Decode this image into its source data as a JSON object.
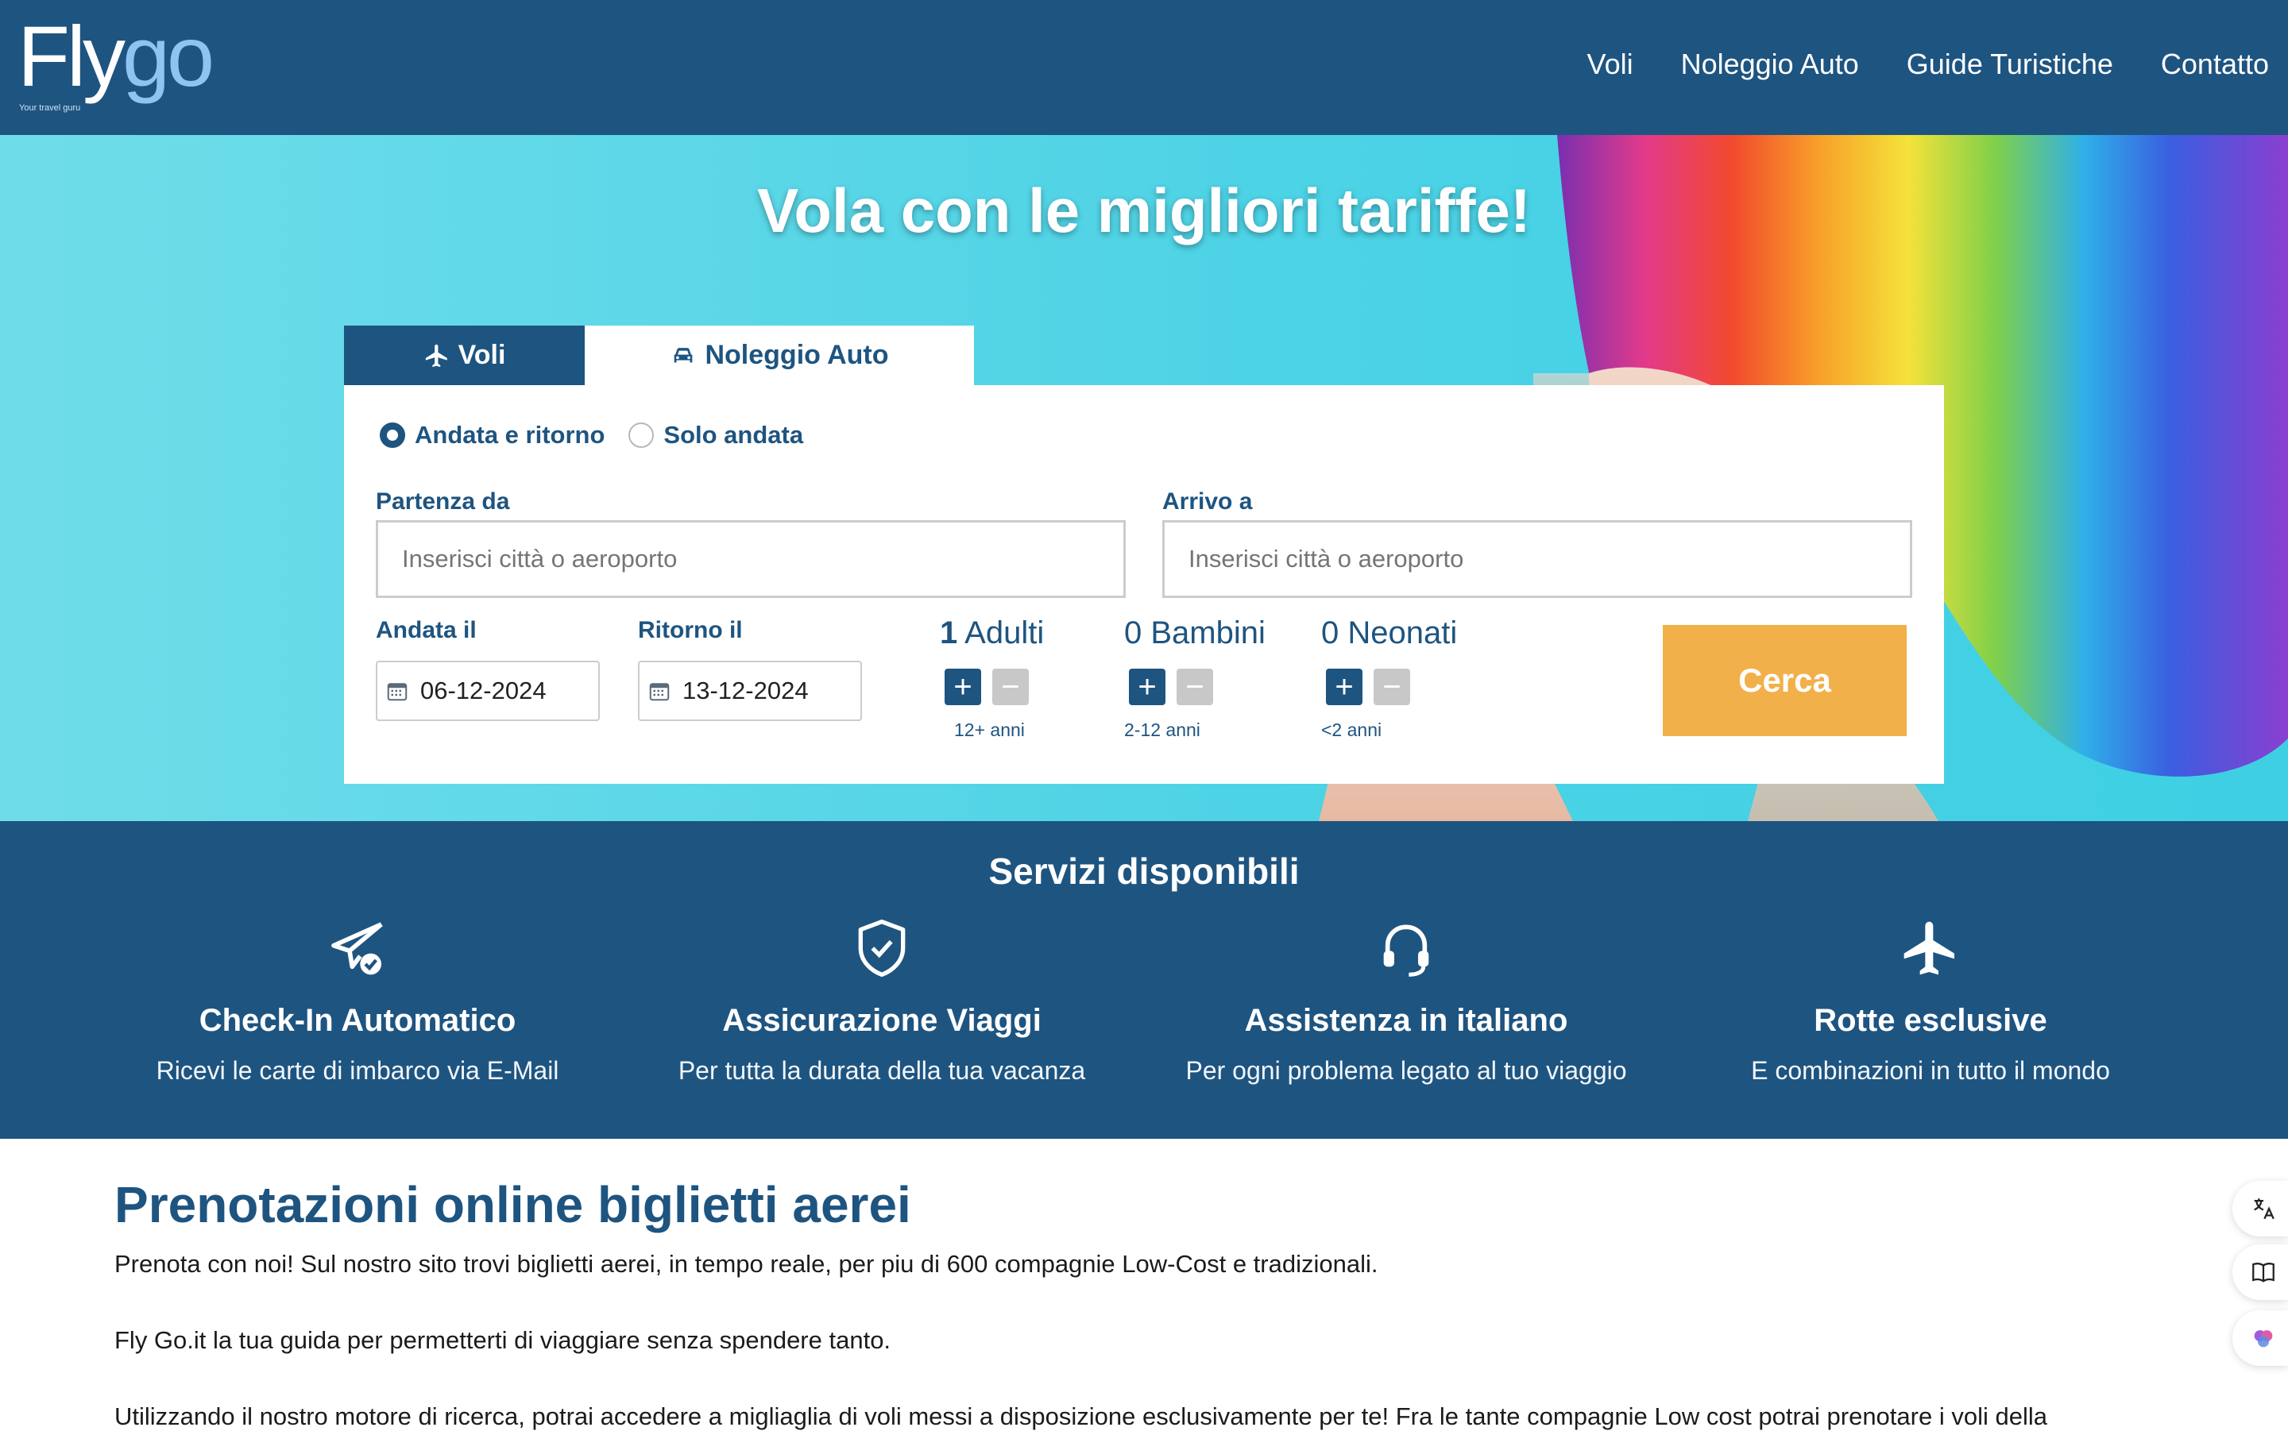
{
  "brand": {
    "name_part1": "Fly",
    "name_part2": "go",
    "tagline": "Your travel guru"
  },
  "nav": {
    "items": [
      "Voli",
      "Noleggio Auto",
      "Guide Turistiche",
      "Contatto"
    ]
  },
  "hero": {
    "title": "Vola con le migliori tariffe!"
  },
  "search": {
    "tabs": {
      "flights": "Voli",
      "cars": "Noleggio Auto"
    },
    "trip_type": {
      "round_trip": "Andata e ritorno",
      "one_way": "Solo andata",
      "selected": "round_trip"
    },
    "from": {
      "label": "Partenza da",
      "placeholder": "Inserisci città o aeroporto"
    },
    "to": {
      "label": "Arrivo a",
      "placeholder": "Inserisci città o aeroporto"
    },
    "depart": {
      "label": "Andata il",
      "value": "06-12-2024"
    },
    "return": {
      "label": "Ritorno il",
      "value": "13-12-2024"
    },
    "adults": {
      "count": "1",
      "label": "Adulti",
      "age": "12+ anni"
    },
    "children": {
      "count": "0",
      "label": "Bambini",
      "age": "2-12 anni"
    },
    "infants": {
      "count": "0",
      "label": "Neonati",
      "age": "<2 anni"
    },
    "button": "Cerca"
  },
  "services": {
    "title": "Servizi disponibili",
    "items": [
      {
        "icon": "paper-plane-check-icon",
        "title": "Check-In Automatico",
        "desc": "Ricevi le carte di imbarco via E-Mail"
      },
      {
        "icon": "shield-check-icon",
        "title": "Assicurazione Viaggi",
        "desc": "Per tutta la durata della tua vacanza"
      },
      {
        "icon": "headset-icon",
        "title": "Assistenza in italiano",
        "desc": "Per ogni problema legato al tuo viaggio"
      },
      {
        "icon": "airplane-icon",
        "title": "Rotte esclusive",
        "desc": "E combinazioni in tutto il mondo"
      }
    ]
  },
  "content": {
    "heading": "Prenotazioni online biglietti aerei",
    "p1": "Prenota con noi! Sul nostro sito trovi biglietti aerei, in tempo reale, per piu di 600 compagnie Low-Cost e tradizionali.",
    "p2": "Fly Go.it la tua guida per permetterti di viaggiare senza spendere tanto.",
    "p3": "Utilizzando il nostro motore di ricerca, potrai accedere a migliaglia di voli messi a disposizione esclusivamente per te! Fra le tante compagnie Low cost potrai prenotare i voli della"
  },
  "colors": {
    "primary": "#1e5480",
    "accent": "#f2b04a",
    "hero_bg": "#4dd3e6"
  },
  "side_widgets": [
    "translate-icon",
    "book-icon",
    "brain-icon"
  ]
}
